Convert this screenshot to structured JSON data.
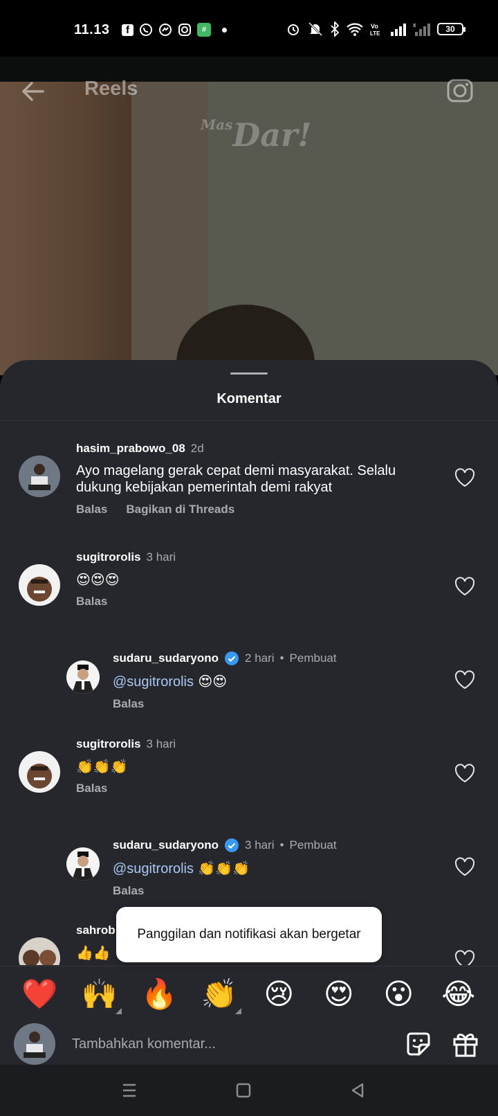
{
  "status_bar": {
    "time": "11.13",
    "app_icons": [
      "facebook-icon",
      "whatsapp-icon",
      "messenger-icon",
      "instagram-icon",
      "green-app-icon"
    ],
    "battery": "30"
  },
  "video": {
    "header_title": "Reels",
    "watermark": "Dar!",
    "watermark_prefix": "Mas"
  },
  "sheet": {
    "title": "Komentar"
  },
  "comments": [
    {
      "username": "hasim_prabowo_08",
      "time": "2d",
      "text": "Ayo magelang gerak cepat demi masyarakat.  Selalu dukung kebijakan pemerintah demi rakyat",
      "reply_label": "Balas",
      "share_label": "Bagikan di Threads"
    },
    {
      "username": "sugitrorolis",
      "time": "3 hari",
      "text": "😍😍😍",
      "reply_label": "Balas"
    },
    {
      "username": "sudaru_sudaryono",
      "time": "2 hari",
      "creator_label": "Pembuat",
      "mention": "@sugitrorolis",
      "text": " 😍😍",
      "reply_label": "Balas"
    },
    {
      "username": "sugitrorolis",
      "time": "3 hari",
      "text": "👏👏👏",
      "reply_label": "Balas"
    },
    {
      "username": "sudaru_sudaryono",
      "time": "3 hari",
      "creator_label": "Pembuat",
      "mention": "@sugitrorolis",
      "text": " 👏👏👏",
      "reply_label": "Balas"
    },
    {
      "username": "sahrob",
      "text": "👍👍"
    }
  ],
  "reactions": [
    "❤️",
    "🙌",
    "🔥",
    "👏",
    "😢",
    "😍",
    "😮",
    "😂"
  ],
  "input": {
    "placeholder": "Tambahkan komentar..."
  },
  "toast": {
    "text": "Panggilan dan notifikasi akan bergetar"
  },
  "colors": {
    "sheet_bg": "#25272c",
    "verified_blue": "#3897f0",
    "mention_blue": "#a9c9f2",
    "muted_text": "#a8abb0"
  }
}
